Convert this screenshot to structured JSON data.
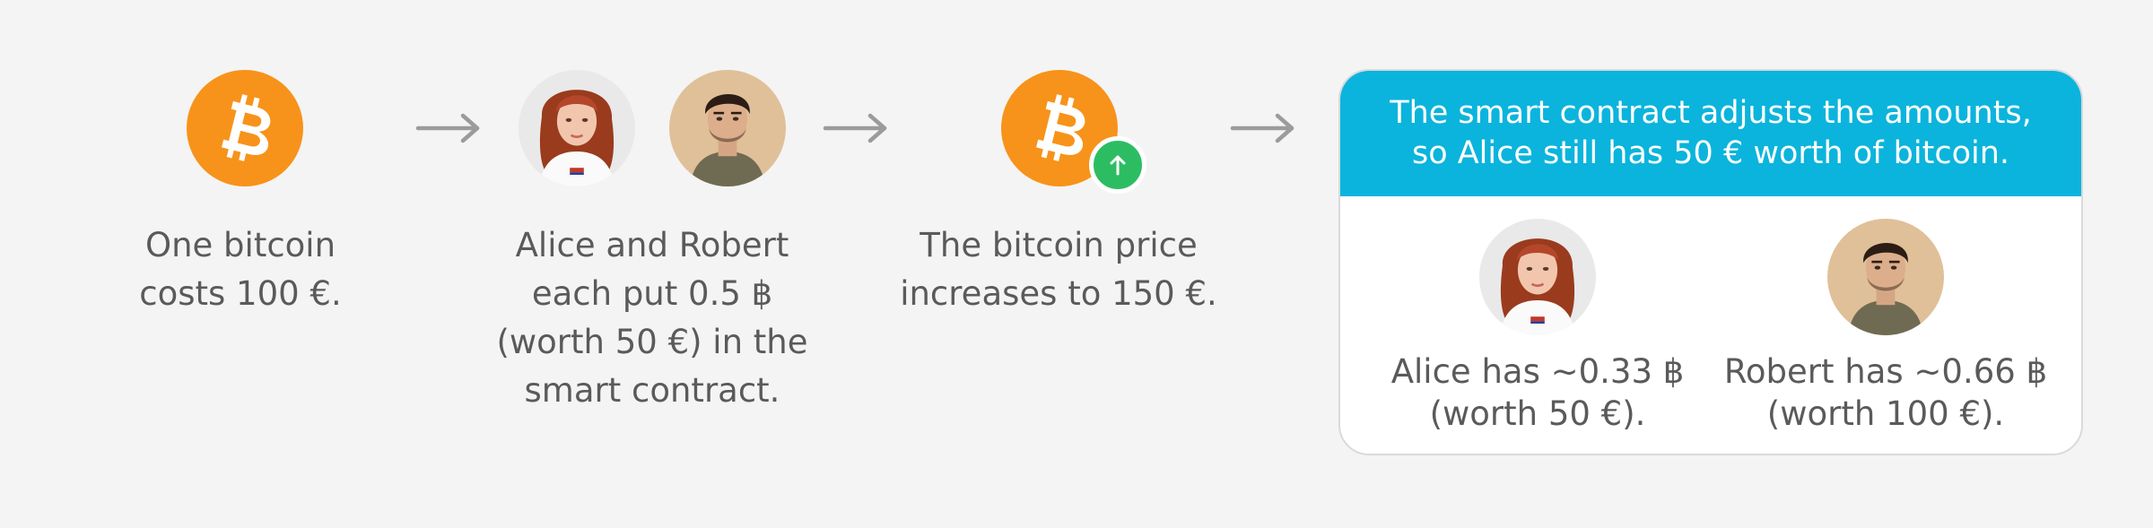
{
  "colors": {
    "background": "#f4f4f4",
    "bitcoin_orange": "#f7931a",
    "increase_green": "#2cbd63",
    "panel_header": "#0bb4dc",
    "arrow": "#9b9b9b",
    "text": "#5a5a5a"
  },
  "steps": [
    {
      "icon": "bitcoin-icon",
      "caption": [
        "One bitcoin",
        "costs 100 €."
      ]
    },
    {
      "icon": "alice-and-robert-avatars",
      "caption": [
        "Alice and Robert",
        "each put 0.5 ฿",
        "(worth 50 €) in the",
        "smart contract."
      ]
    },
    {
      "icon": "bitcoin-price-up-icon",
      "caption": [
        "The bitcoin price",
        "increases to 150 €."
      ]
    }
  ],
  "result_panel": {
    "header": [
      "The smart contract adjusts the amounts,",
      "so Alice still has 50 € worth of bitcoin."
    ],
    "alice": [
      "Alice has ~0.33 ฿",
      "(worth 50 €)."
    ],
    "robert": [
      "Robert has ~0.66 ฿",
      "(worth 100 €)."
    ]
  }
}
